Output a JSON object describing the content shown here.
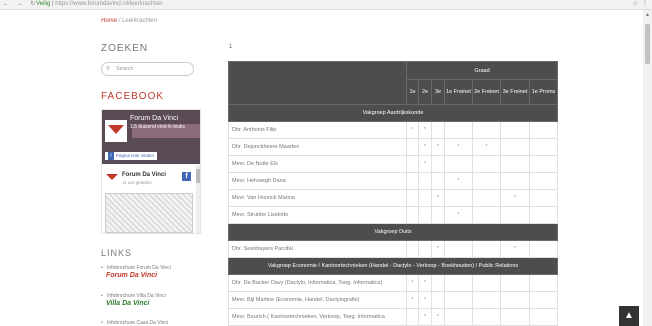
{
  "browser": {
    "nav_icons": "← → ↻",
    "lock_label": "Veilig",
    "url_start": "https://",
    "url_rest": "www.forumdavinci.nl/leerkrachten",
    "star_icon": "☆",
    "menu_icon": "⋮"
  },
  "breadcrumb": {
    "home": "Home",
    "sep": " / ",
    "current": "Leerkrachten"
  },
  "sidebar": {
    "search_heading": "ZOEKEN",
    "search_placeholder": "Search",
    "search_icon": "magnifier",
    "facebook_heading": "FACEBOOK",
    "fb_page_title": "Forum Da Vinci",
    "fb_page_sub": "1,5 duizend vind-ik-leuks",
    "fb_like_button": "Pagina leuk vinden",
    "fb_post_name": "Forum Da Vinci",
    "fb_post_time": "11 uur geleden",
    "links_heading": "LINKS",
    "links": [
      {
        "text": "Infobrochure Forum Da Vinci",
        "brand": "Forum Da Vinci",
        "color": "#c0392b"
      },
      {
        "text": "Infobrochure Villa Da Vinci",
        "brand": "Villa Da Vinci",
        "color": "#2e7d32"
      },
      {
        "text": "Infobrochure Casa Da Vinci",
        "brand": "",
        "color": "#777777"
      }
    ]
  },
  "main": {
    "index_label": "1",
    "graad_label": "Graad",
    "columns": [
      "1e",
      "2e",
      "3e",
      "1e Freinet",
      "2e Freinet",
      "3e Freinet",
      "1e Proms"
    ],
    "sections": [
      {
        "title": "Vakgroep Aardrijkskunde",
        "rows": [
          {
            "name": "Dhr. Anthonis Filip",
            "marks": [
              "*",
              "*",
              "",
              "",
              "",
              "",
              ""
            ]
          },
          {
            "name": "Dhr. Dejonckheere Maarten",
            "marks": [
              "",
              "*",
              "*",
              "*",
              "*",
              "",
              ""
            ]
          },
          {
            "name": "Mevr. De Nutte Els",
            "marks": [
              "",
              "*",
              "",
              "",
              "",
              "",
              ""
            ]
          },
          {
            "name": "Mevr. Helvwegh Dana",
            "marks": [
              "",
              "",
              "",
              "*",
              "",
              "",
              ""
            ]
          },
          {
            "name": "Mevr. Van Hoorick Marina",
            "marks": [
              "",
              "",
              "*",
              "",
              "",
              "*",
              ""
            ]
          },
          {
            "name": "Mevr. Strubbe Liselotte",
            "marks": [
              "",
              "",
              "",
              "*",
              "",
              "",
              ""
            ]
          }
        ]
      },
      {
        "title": "Vakgroep Duits",
        "rows": [
          {
            "name": "Dhr. Seeldrayers Parcifal",
            "marks": [
              "",
              "",
              "*",
              "",
              "",
              "*",
              ""
            ]
          }
        ]
      },
      {
        "title": "Vakgroep Economie / Kantoortechnieken (Handel - Dactylo - Verkoop - Boekhouden) / Public Relations",
        "rows": [
          {
            "name": "Dhr. De Backer Davy (Dactylo, Informatica, Toeg. Informatica)",
            "marks": [
              "*",
              "*",
              "",
              "",
              "",
              "",
              ""
            ]
          },
          {
            "name": "Mevr. Bijl Martine (Economie, Handel, Dactylografie)",
            "marks": [
              "*",
              "*",
              "",
              "",
              "",
              "",
              ""
            ]
          },
          {
            "name": "Mevr. Bourich ( Kantoortechnieken, Verkoop, Toeg. Informatica",
            "marks": [
              "",
              "*",
              "*",
              "",
              "",
              "",
              ""
            ]
          }
        ]
      }
    ]
  },
  "back_to_top_icon": "▲"
}
